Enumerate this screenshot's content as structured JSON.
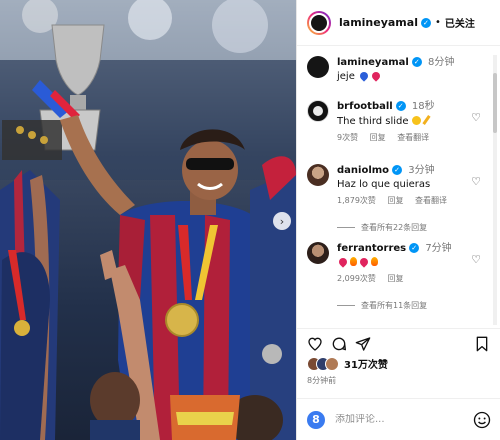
{
  "header": {
    "username": "lamineyamal",
    "separator": "•",
    "follow_state": "已关注"
  },
  "caption": {
    "username": "lamineyamal",
    "time": "8分钟",
    "text": "jeje"
  },
  "comments": [
    {
      "username": "brfootball",
      "time": "18秒",
      "text": "The third slide",
      "likes": "9次赞",
      "reply": "回复",
      "translate": "查看翻译"
    },
    {
      "username": "daniolmo",
      "time": "3分钟",
      "text": "Haz lo que quieras",
      "likes": "1,879次赞",
      "reply": "回复",
      "translate": "查看翻译",
      "view_replies": "查看所有22条回复"
    },
    {
      "username": "ferrantorres",
      "time": "7分钟",
      "likes": "2,099次赞",
      "reply": "回复",
      "view_replies": "查看所有11条回复"
    }
  ],
  "post": {
    "likes": "31万次赞",
    "time": "8分钟前"
  },
  "comment_box": {
    "placeholder": "添加评论..."
  },
  "icons": {
    "carousel_next": "chevron-right-icon",
    "like": "heart-icon",
    "comment": "comment-icon",
    "share": "send-icon",
    "save": "bookmark-icon",
    "emoji": "smile-icon"
  },
  "colors": {
    "verified": "#0095f6",
    "meta_text": "#777777"
  }
}
